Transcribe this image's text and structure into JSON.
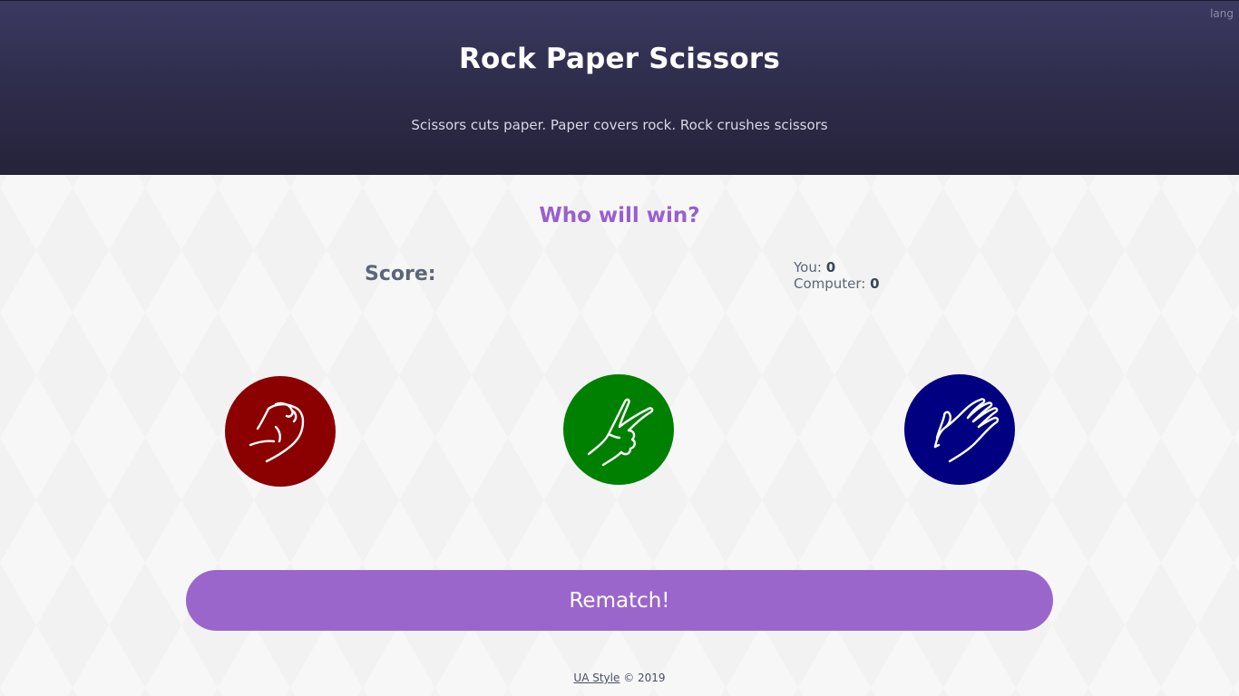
{
  "header": {
    "lang_label": "lang",
    "title": "Rock Paper Scissors",
    "subtitle": "Scissors cuts paper. Paper covers rock. Rock crushes scissors"
  },
  "main": {
    "question": "Who will win?",
    "score_label": "Score:",
    "you_label": "You:",
    "you_score": "0",
    "computer_label": "Computer:",
    "computer_score": "0"
  },
  "choices": [
    {
      "name": "rock",
      "icon": "fist-icon",
      "color": "#8b0000"
    },
    {
      "name": "scissors",
      "icon": "victory-hand-icon",
      "color": "#008000"
    },
    {
      "name": "paper",
      "icon": "open-hand-icon",
      "color": "#000080"
    }
  ],
  "rematch_label": "Rematch!",
  "footer": {
    "link_text": "UA Style",
    "copyright": "© 2019"
  },
  "colors": {
    "header_bg": "#2f2d4b",
    "accent": "#9a66cb",
    "rock": "#8b0000",
    "scissors": "#008000",
    "paper": "#000080"
  }
}
